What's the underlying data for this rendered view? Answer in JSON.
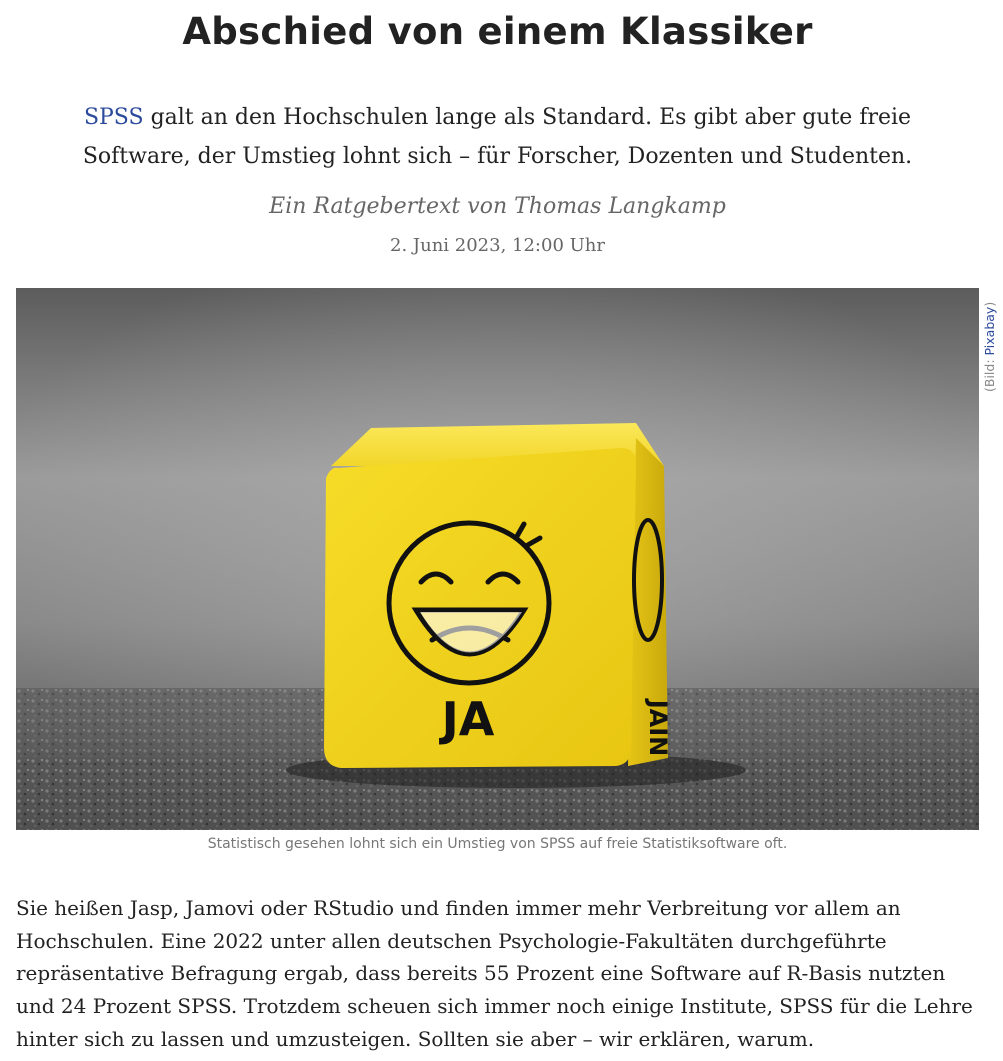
{
  "article": {
    "title": "Abschied von einem Klassiker",
    "lead_link": "SPSS",
    "lead_text": " galt an den Hochschulen lange als Standard. Es gibt aber gute freie Software, der Umstieg lohnt sich – für Forscher, Dozenten und Studenten.",
    "byline": "Ein Ratgebertext von Thomas Langkamp",
    "date": "2. Juni 2023, 12:00 Uhr"
  },
  "figure": {
    "credit_prefix": "(Bild: ",
    "credit_link": "Pixabay",
    "credit_suffix": ")",
    "caption": "Statistisch gesehen lohnt sich ein Umstieg von SPSS auf freie Statistiksoftware oft.",
    "dice_front_label": "JA",
    "dice_side_label": "JAIN",
    "dice_color": "#f3d823",
    "icon": "laughing-smiley-dice-photo"
  },
  "body": {
    "paragraph_1": "Sie heißen Jasp, Jamovi oder RStudio und finden immer mehr Verbreitung vor allem an Hochschulen. Eine 2022 unter allen deutschen Psychologie-Fakultäten durchgeführte repräsentative Befragung ergab, dass bereits 55 Prozent eine Software auf R-Basis nutzten und 24 Prozent SPSS. Trotzdem scheuen sich immer noch einige Institute, SPSS für die Lehre hinter sich zu lassen und umzusteigen. Sollten sie aber – wir erklären, warum."
  }
}
